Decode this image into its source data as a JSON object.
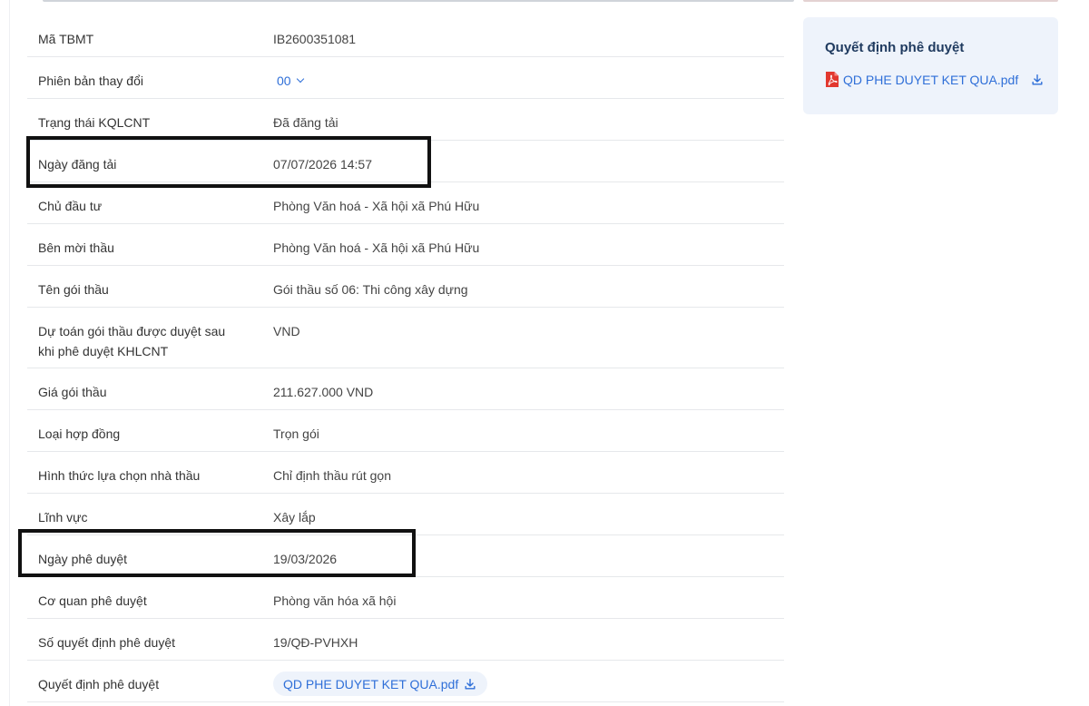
{
  "details": {
    "rows": [
      {
        "label": "Mã TBMT",
        "value": "IB2600351081"
      },
      {
        "label": "Phiên bản thay đổi",
        "value": "00"
      },
      {
        "label": "Trạng thái KQLCNT",
        "value": "Đã đăng tải"
      },
      {
        "label": "Ngày đăng tải",
        "value": "07/07/2026 14:57"
      },
      {
        "label": "Chủ đầu tư",
        "value": "Phòng Văn hoá - Xã hội xã Phú Hữu"
      },
      {
        "label": "Bên mời thầu",
        "value": "Phòng Văn hoá - Xã hội xã Phú Hữu"
      },
      {
        "label": "Tên gói thầu",
        "value": "Gói thầu số 06: Thi công xây dựng"
      },
      {
        "label": "Dự toán gói thầu được duyệt sau khi phê duyệt KHLCNT",
        "value": "VND"
      },
      {
        "label": "Giá gói thầu",
        "value": "211.627.000 VND"
      },
      {
        "label": "Loại hợp đồng",
        "value": "Trọn gói"
      },
      {
        "label": "Hình thức lựa chọn nhà thầu",
        "value": "Chỉ định thầu rút gọn"
      },
      {
        "label": "Lĩnh vực",
        "value": "Xây lắp"
      },
      {
        "label": "Ngày phê duyệt",
        "value": "19/03/2026"
      },
      {
        "label": "Cơ quan phê duyệt",
        "value": "Phòng văn hóa xã hội"
      },
      {
        "label": "Số quyết định phê duyệt",
        "value": "19/QĐ-PVHXH"
      },
      {
        "label": "Quyết định phê duyệt",
        "value": "QD PHE DUYET KET QUA.pdf"
      }
    ]
  },
  "sidebar": {
    "title": "Quyết định phê duyệt",
    "file_name": "QD PHE DUYET KET QUA.pdf"
  },
  "icons": {
    "version_dropdown": "chevron-down-icon",
    "download": "download-icon",
    "pdf": "pdf-file-icon"
  },
  "colors": {
    "link": "#2f6fd8",
    "chip_background": "#eef3fb",
    "pdf_red": "#e2382f",
    "highlight_border": "#111111"
  }
}
